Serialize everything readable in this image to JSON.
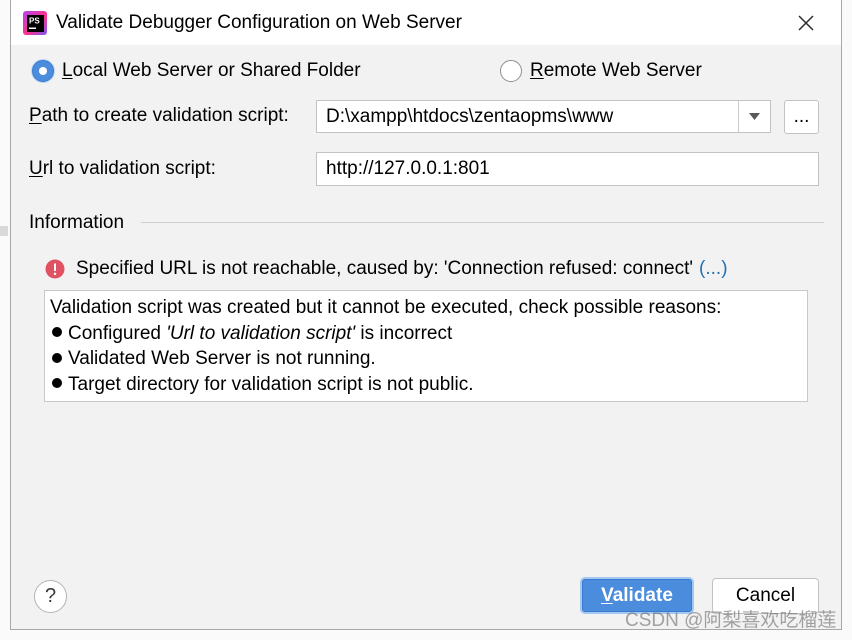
{
  "window": {
    "title": "Validate Debugger Configuration on Web Server",
    "app_icon_text": "PS",
    "app_icon": "phpstorm-logo-icon",
    "close_icon": "close-icon"
  },
  "server_type": {
    "options": [
      {
        "mnemonic": "L",
        "label_rest": "ocal Web Server or Shared Folder",
        "selected": true
      },
      {
        "mnemonic": "R",
        "label_rest": "emote Web Server",
        "selected": false
      }
    ]
  },
  "path_field": {
    "label_mnemonic": "P",
    "label_rest": "ath to create validation script:",
    "value": "D:\\xampp\\htdocs\\zentaopms\\www",
    "dropdown_icon": "dropdown-arrow-icon",
    "browse_label": "..."
  },
  "url_field": {
    "label_mnemonic": "U",
    "label_rest": "rl to validation script:",
    "value": "http://127.0.0.1:801"
  },
  "information": {
    "heading": "Information",
    "error_icon": "error-icon",
    "error_message": "Specified URL is not reachable, caused by: 'Connection refused: connect'",
    "details_link": "(...)",
    "details": {
      "intro": "Validation script was created but it cannot be executed, check possible reasons:",
      "reasons": [
        {
          "before": "Configured ",
          "emphasis": "'Url to validation script'",
          "after": " is incorrect"
        },
        {
          "text": "Validated Web Server is not running."
        },
        {
          "text": "Target directory for validation script is not public."
        }
      ]
    }
  },
  "footer": {
    "help_label": "?",
    "validate_mnemonic": "V",
    "validate_rest": "alidate",
    "cancel_label": "Cancel"
  },
  "watermark": "CSDN @阿梨喜欢吃榴莲",
  "colors": {
    "dialog_background": "#f2f2f2",
    "accent": "#4b8ddc",
    "focus_ring": "#a3c9f2",
    "error": "#e05261",
    "link": "#2470b3"
  }
}
